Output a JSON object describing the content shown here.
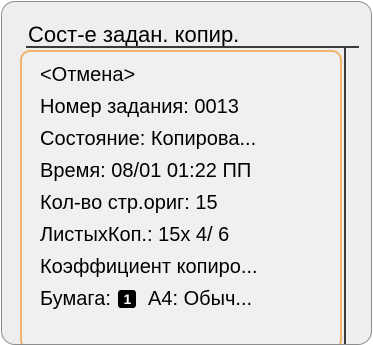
{
  "screen": {
    "title": "Сост-е задан. копир."
  },
  "items": [
    {
      "label": "<Отмена>"
    },
    {
      "label": "Номер задания: 0013"
    },
    {
      "label": "Состояние: Копирова..."
    },
    {
      "label": "Время: 08/01 01:22 ПП"
    },
    {
      "label": "Кол-во стр.ориг:  15"
    },
    {
      "label": "ЛистыхКоп.: 15x 4/ 6"
    },
    {
      "label": "Коэффициент копиро..."
    },
    {
      "label_prefix": "Бумага:",
      "tray_number": "1",
      "label_suffix": "A4: Обыч..."
    }
  ],
  "colors": {
    "selection_border": "#f0b46c",
    "background": "#eeeeee"
  }
}
